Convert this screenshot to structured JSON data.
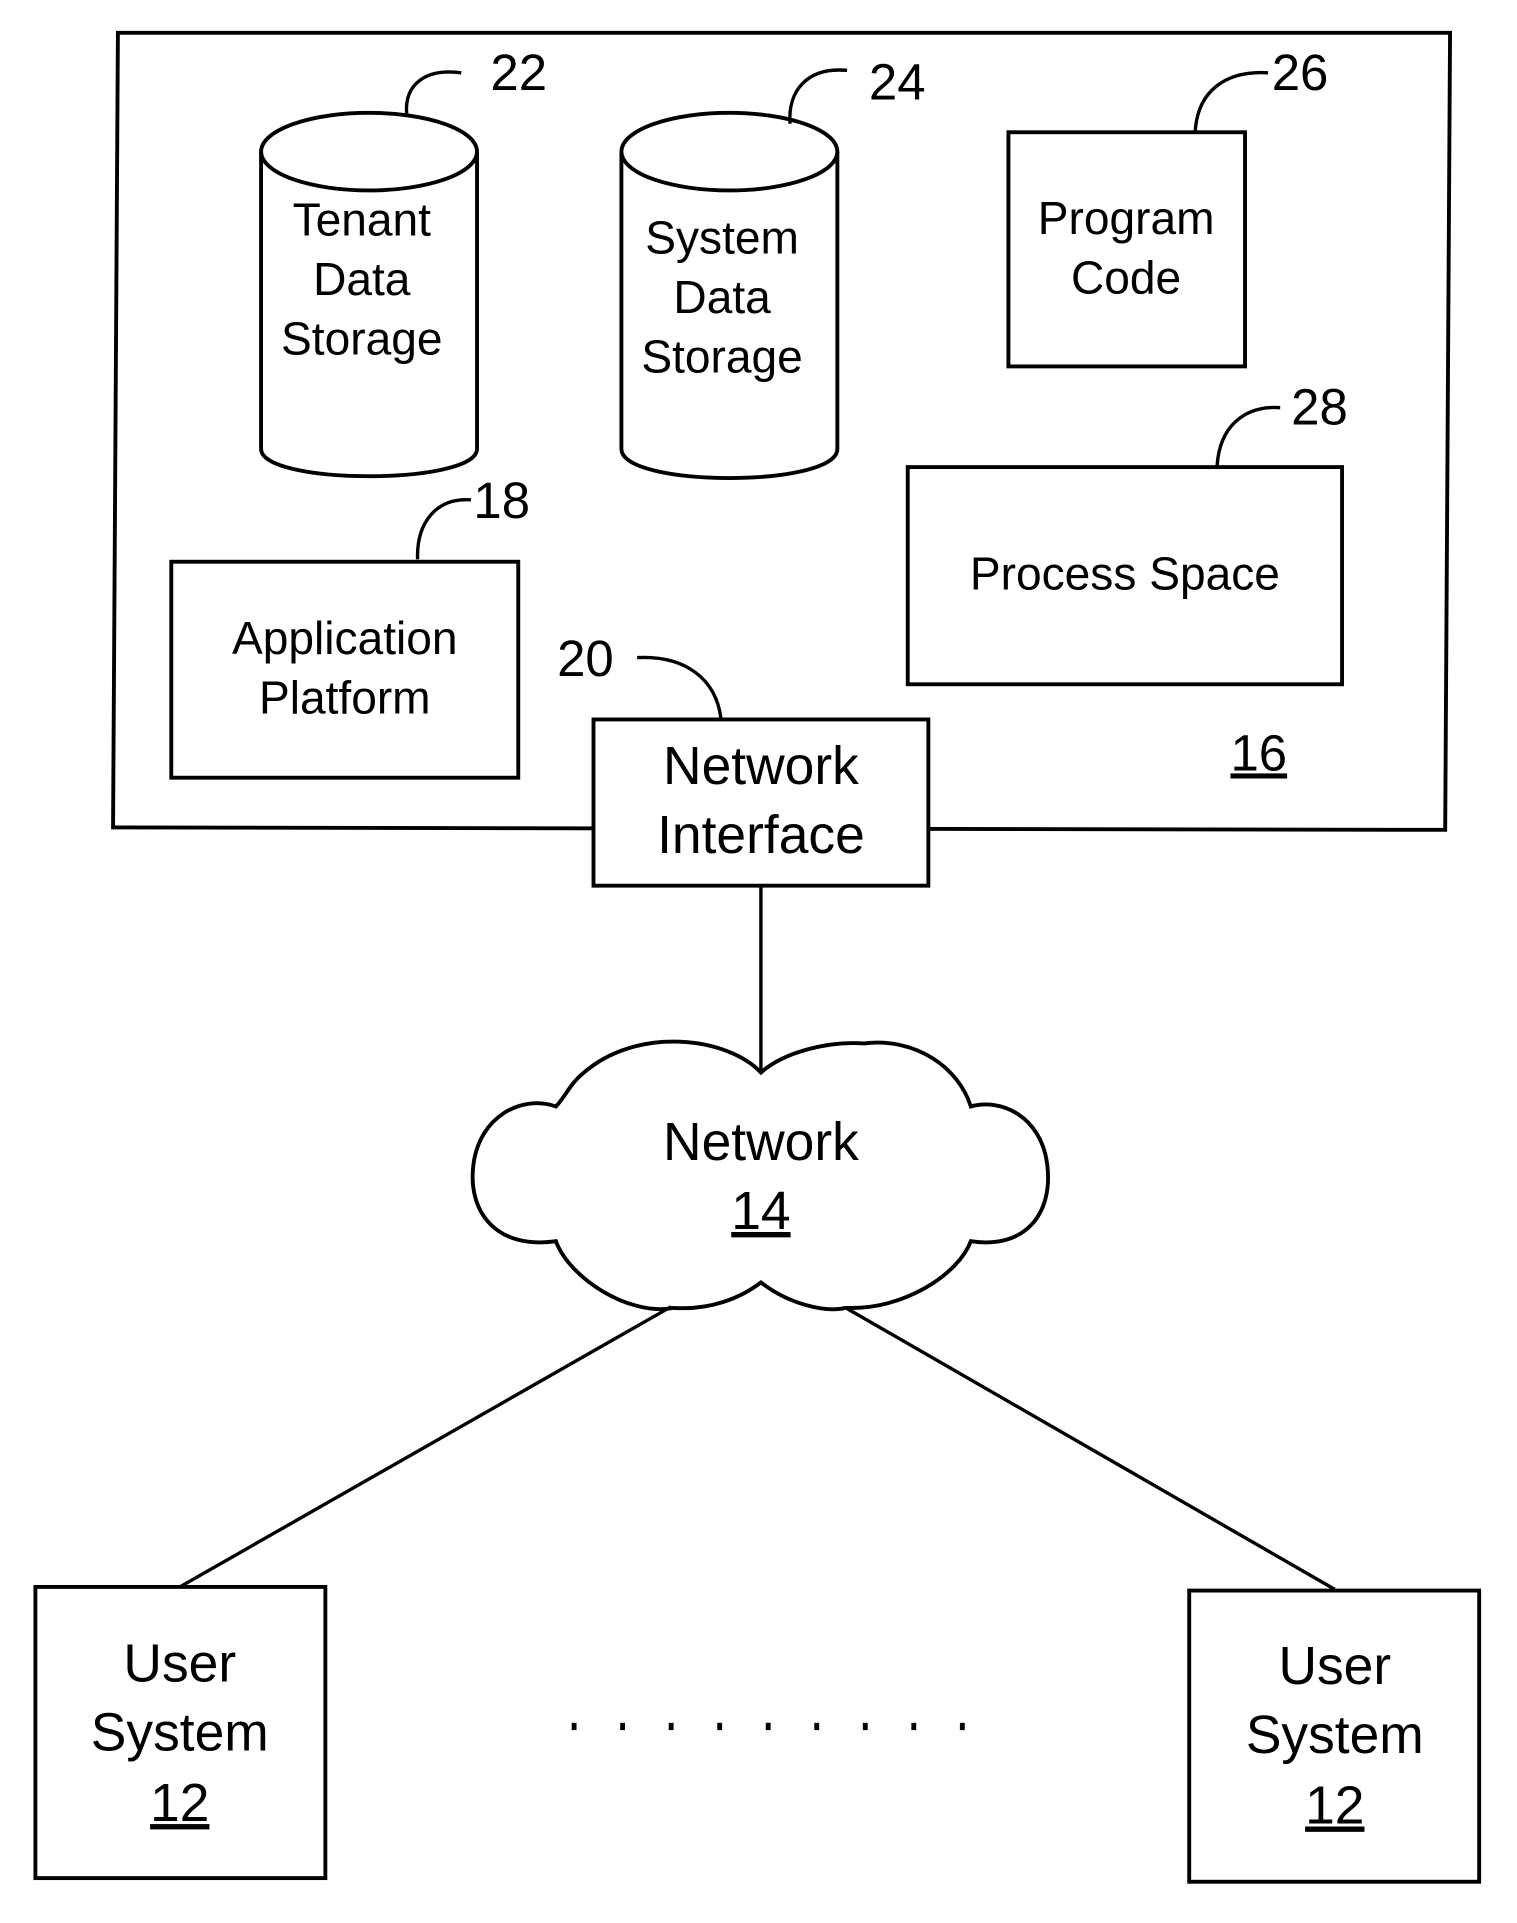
{
  "diagram": {
    "server_system": {
      "ref": "16",
      "components": {
        "tenant_data_storage": {
          "ref": "22",
          "label_lines": [
            "Tenant",
            "Data",
            "Storage"
          ]
        },
        "system_data_storage": {
          "ref": "24",
          "label_lines": [
            "System",
            "Data",
            "Storage"
          ]
        },
        "program_code": {
          "ref": "26",
          "label_lines": [
            "Program",
            "Code"
          ]
        },
        "process_space": {
          "ref": "28",
          "label_lines": [
            "Process Space"
          ]
        },
        "application_platform": {
          "ref": "18",
          "label_lines": [
            "Application",
            "Platform"
          ]
        },
        "network_interface": {
          "ref": "20",
          "label_lines": [
            "Network",
            "Interface"
          ]
        }
      }
    },
    "network": {
      "label": "Network",
      "ref": "14"
    },
    "user_systems": [
      {
        "label_lines": [
          "User",
          "System"
        ],
        "ref": "12"
      },
      {
        "label_lines": [
          "User",
          "System"
        ],
        "ref": "12"
      }
    ],
    "ellipsis_dot_count": 9
  }
}
